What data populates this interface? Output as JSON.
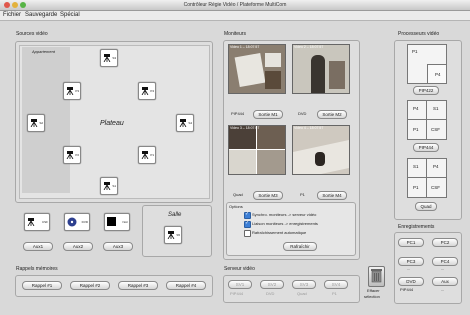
{
  "window": {
    "title": "Contrôleur Régie Vidéo / Plateforme MultiCom"
  },
  "menu": {
    "fichier": "Fichier",
    "sauvegarde": "Sauvegarde",
    "special": "Spécial"
  },
  "sources": {
    "title": "Sources vidéo",
    "appartement": "Appartement",
    "plateau": "Plateau",
    "cams": {
      "s3": "S3",
      "p3": "P3",
      "p4": "P4",
      "s2": "S2",
      "s4": "S4",
      "p2": "P2",
      "p1": "P1",
      "s1": "S1"
    },
    "devices": {
      "csf": "CSF",
      "dvd": "DVD",
      "noir": "Noir"
    },
    "aux": [
      "Aux1",
      "Aux2",
      "Aux3"
    ],
    "salle": "Salle",
    "salle_cam": "S5"
  },
  "rappels": {
    "title": "Rappels mémoires",
    "buttons": [
      "Rappel #1",
      "Rappel #2",
      "Rappel #3",
      "Rappel #4"
    ]
  },
  "moniteurs": {
    "title": "Moniteurs",
    "monitors": [
      {
        "label": "Video 1 – 18:07:57",
        "name": "PIP444",
        "button": "Sortie M1"
      },
      {
        "label": "Video 2 – 18:07:57",
        "name": "DVD",
        "button": "Sortie M2"
      },
      {
        "label": "Video 3 – 18:07:57",
        "name": "Quad",
        "button": "Sortie M3"
      },
      {
        "label": "Video 4 – 18:07:57",
        "name": "P1",
        "button": "Sortie M4"
      }
    ],
    "options": {
      "title": "Options",
      "items": [
        {
          "text": "Synchro. moniteurs -> serveur vidéo",
          "checked": true
        },
        {
          "text": "Liaison moniteurs -> enregistrements",
          "checked": true
        },
        {
          "text": "Rafraîchissement automatique",
          "checked": false
        }
      ],
      "refresh": "Rafraîchir"
    }
  },
  "serveur": {
    "title": "Serveur vidéo",
    "slots": [
      {
        "btn": "SV1",
        "label": "PIP444"
      },
      {
        "btn": "SV2",
        "label": "DVD"
      },
      {
        "btn": "SV3",
        "label": "Quad"
      },
      {
        "btn": "SV4",
        "label": "P1"
      }
    ],
    "clear_line1": "Effacer",
    "clear_line2": "sélection"
  },
  "processeurs": {
    "title": "Processeurs vidéo",
    "p1": {
      "big": "P1",
      "small": "P4",
      "button": "PIP422"
    },
    "p2": {
      "tl": "P4",
      "tr": "S1",
      "bl": "P1",
      "br": "CSF",
      "button": "PIP444"
    },
    "p3": {
      "tl": "S1",
      "tr": "P4",
      "bl": "P1",
      "br": "CSF",
      "button": "Quad"
    }
  },
  "enregistrements": {
    "title": "Enregistrements",
    "rows": [
      {
        "left": "PC1",
        "right": "PC2",
        "left_sub": "",
        "right_sub": ""
      },
      {
        "left": "PC3",
        "right": "PC4",
        "left_sub": "...",
        "right_sub": "..."
      },
      {
        "left": "DVD",
        "right": "Aux",
        "left_sub": "PIP444",
        "right_sub": "..."
      }
    ]
  }
}
